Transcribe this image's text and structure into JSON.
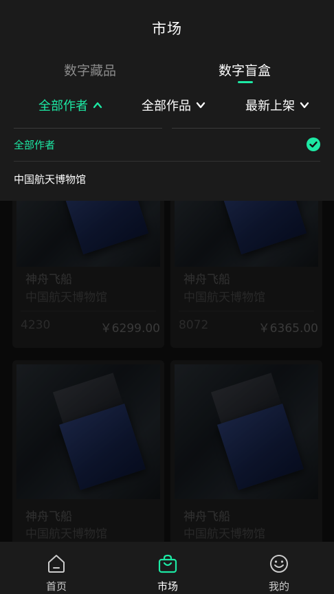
{
  "page_title": "市场",
  "tabs": [
    {
      "label": "数字藏品",
      "active": false
    },
    {
      "label": "数字盲盒",
      "active": true
    }
  ],
  "filters": {
    "author": "全部作者",
    "works": "全部作品",
    "sort": "最新上架"
  },
  "dropdown": {
    "options": [
      {
        "label": "全部作者",
        "selected": true
      },
      {
        "label": "中国航天博物馆",
        "selected": false
      }
    ]
  },
  "cards": [
    {
      "name": "神舟飞船",
      "author": "中国航天博物馆",
      "count": "4230",
      "price": "￥6299.00"
    },
    {
      "name": "神舟飞船",
      "author": "中国航天博物馆",
      "count": "8072",
      "price": "￥6365.00"
    },
    {
      "name": "神舟飞船",
      "author": "中国航天博物馆",
      "count": "",
      "price": ""
    },
    {
      "name": "神舟飞船",
      "author": "中国航天博物馆",
      "count": "",
      "price": ""
    }
  ],
  "bottom_nav": [
    {
      "label": "首页",
      "icon": "home-icon",
      "active": false
    },
    {
      "label": "市场",
      "icon": "bag-icon",
      "active": true
    },
    {
      "label": "我的",
      "icon": "smile-icon",
      "active": false
    }
  ],
  "colors": {
    "accent": "#1de9a4",
    "background": "#111111",
    "panel": "#1b1b1b"
  }
}
